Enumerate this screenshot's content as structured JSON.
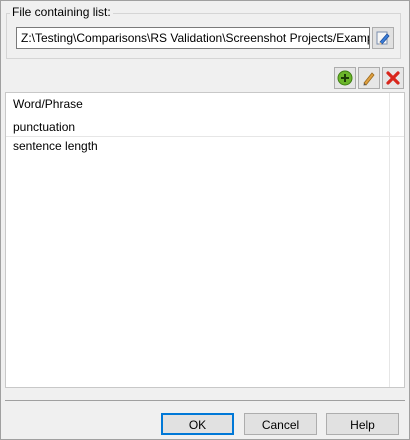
{
  "file_group": {
    "label": "File containing list:",
    "path_value": "Z:\\Testing\\Comparisons\\RS Validation\\Screenshot Projects/Examp",
    "browse_icon": "pencil-browse-icon"
  },
  "toolbar": {
    "add_icon": "plus-circle-icon",
    "add_color": "#6bb52a",
    "edit_icon": "pencil-icon",
    "delete_icon": "red-x-icon",
    "delete_color": "#d9261c"
  },
  "list": {
    "header": "Word/Phrase",
    "rows": [
      "punctuation",
      "sentence length"
    ]
  },
  "buttons": {
    "ok": "OK",
    "cancel": "Cancel",
    "help": "Help"
  }
}
